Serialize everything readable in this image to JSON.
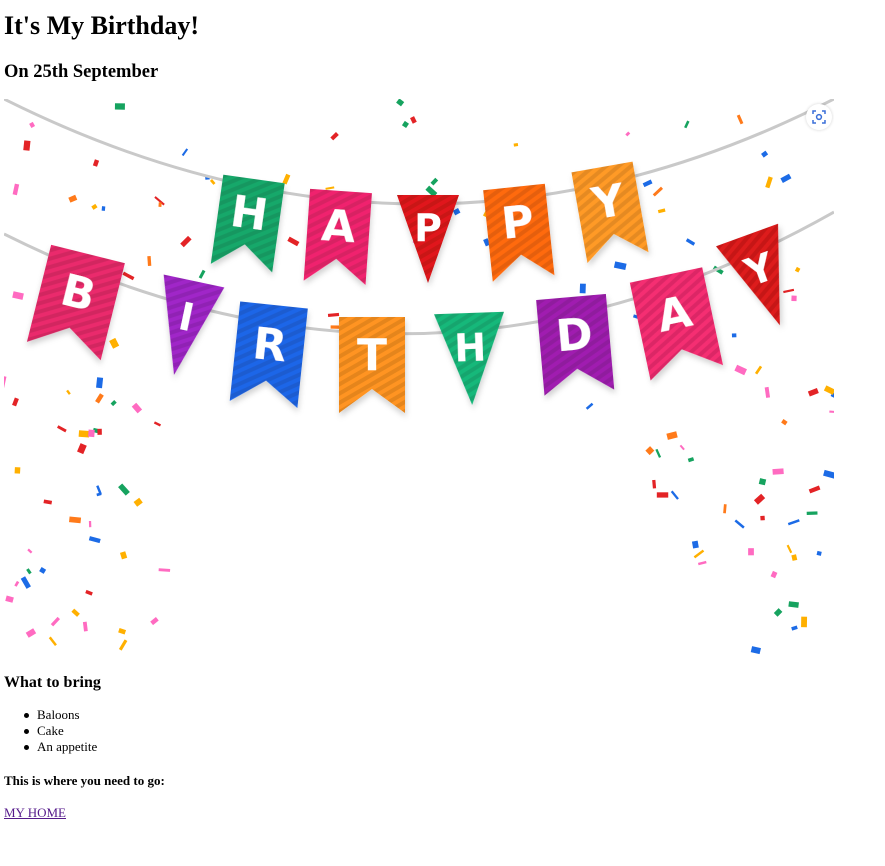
{
  "page": {
    "title": "It's My Birthday!",
    "subtitle": "On 25th September"
  },
  "banner": {
    "image_name": "happy-birthday-banner",
    "top_row_letters": [
      "H",
      "A",
      "P",
      "P",
      "Y"
    ],
    "bottom_row_letters": [
      "B",
      "I",
      "R",
      "T",
      "H",
      "D",
      "A",
      "Y"
    ],
    "top_row_colors": [
      "#14a86b",
      "#f0246e",
      "#e0141a",
      "#ff6a10",
      "#ff9a26"
    ],
    "bottom_row_colors": [
      "#ea2a6c",
      "#a025c8",
      "#1f66e8",
      "#ff9420",
      "#14b87a",
      "#a01fb0",
      "#f52d72",
      "#dd1a1a"
    ],
    "lens_icon": "visual-search-icon"
  },
  "bring": {
    "heading": "What to bring",
    "items": [
      "Baloons",
      "Cake",
      "An appetite"
    ]
  },
  "directions": {
    "text": "This is where you need to go:",
    "link_label": "MY HOME",
    "link_color": "#551a8b"
  }
}
